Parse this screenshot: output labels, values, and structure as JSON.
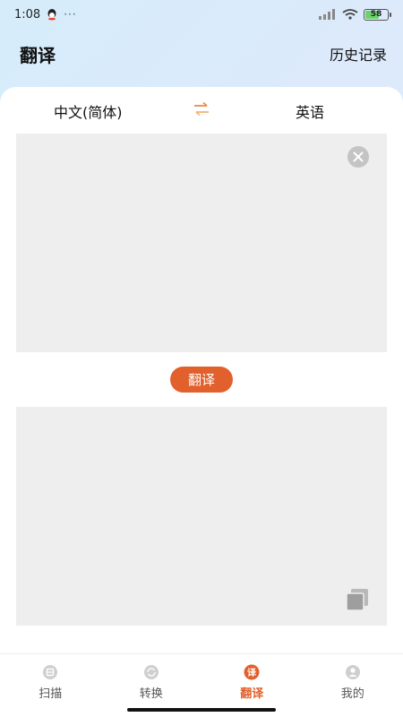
{
  "status_bar": {
    "time": "1:08",
    "dots": "···",
    "battery": "58"
  },
  "header": {
    "title": "翻译",
    "history_label": "历史记录"
  },
  "languages": {
    "source": "中文(简体)",
    "target": "英语"
  },
  "input": {
    "value": "",
    "placeholder": ""
  },
  "translate_button_label": "翻译",
  "output": {
    "value": ""
  },
  "tabs": [
    {
      "label": "扫描",
      "icon": "scan-icon",
      "active": false
    },
    {
      "label": "转换",
      "icon": "convert-icon",
      "active": false
    },
    {
      "label": "翻译",
      "icon": "translate-icon",
      "active": true
    },
    {
      "label": "我的",
      "icon": "profile-icon",
      "active": false
    }
  ],
  "colors": {
    "accent": "#e2602c",
    "box_bg": "#eeeeee",
    "icon_gray": "#c4c4c4"
  }
}
